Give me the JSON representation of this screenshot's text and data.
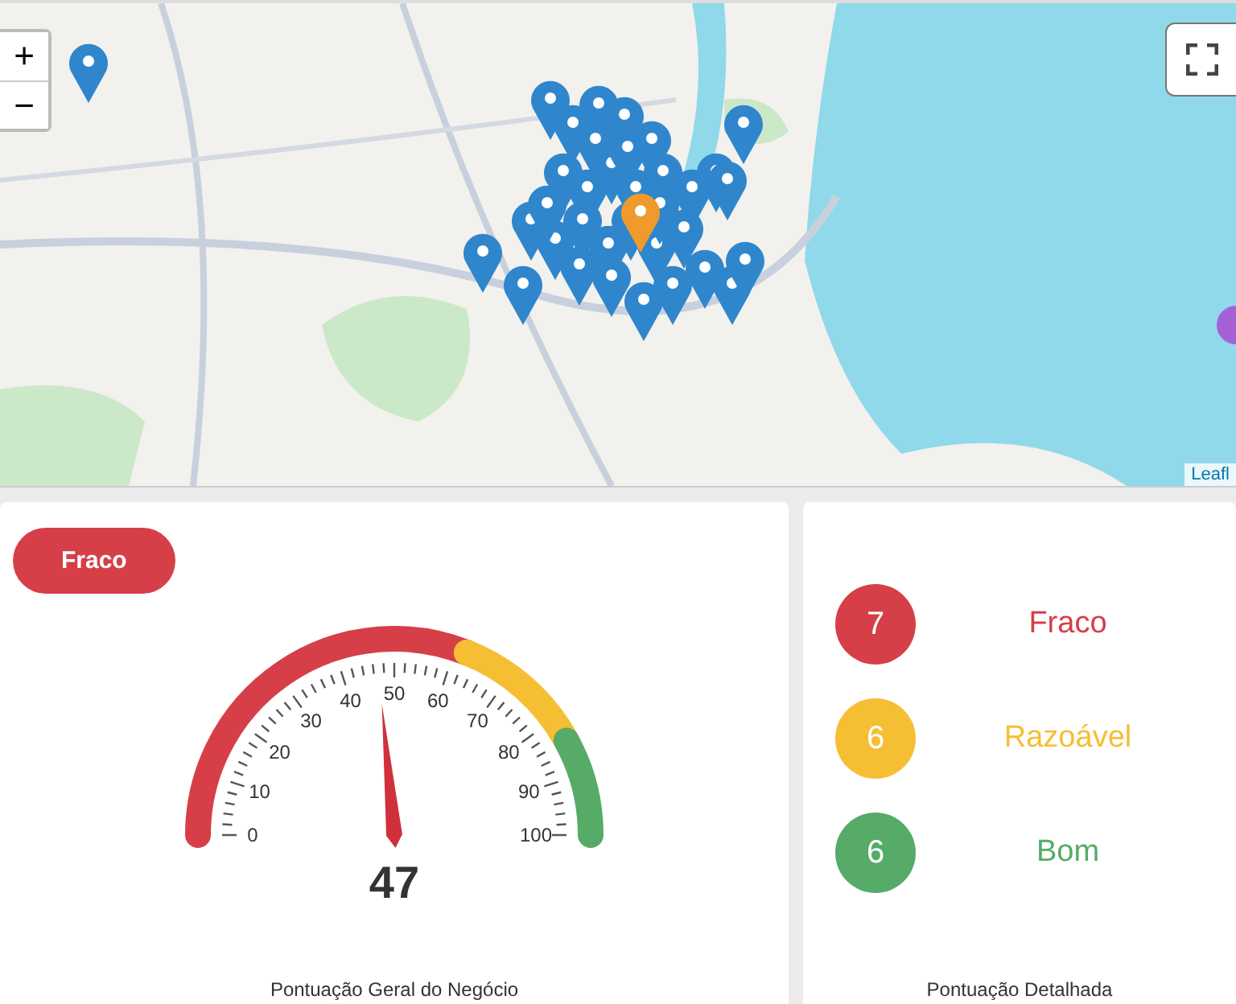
{
  "map": {
    "zoom_in": "+",
    "zoom_out": "−",
    "attribution": "Leafl"
  },
  "score_card": {
    "badge": "Fraco",
    "gauge": {
      "ticks": [
        "0",
        "10",
        "20",
        "30",
        "40",
        "50",
        "60",
        "70",
        "80",
        "90",
        "100"
      ],
      "value": "47"
    },
    "caption": "Pontuação Geral do Negócio"
  },
  "detail_card": {
    "rows": [
      {
        "count": "7",
        "label": "Fraco",
        "color": "#d63f47"
      },
      {
        "count": "6",
        "label": "Razoável",
        "color": "#f6be32"
      },
      {
        "count": "6",
        "label": "Bom",
        "color": "#56ab66"
      }
    ],
    "caption": "Pontuação Detalhada"
  }
}
